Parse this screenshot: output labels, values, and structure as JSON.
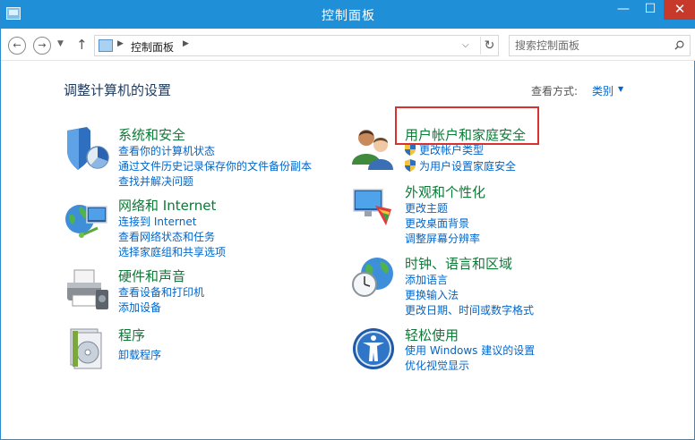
{
  "window": {
    "title": "控制面板",
    "min": "—",
    "max": "☐",
    "close": "✕"
  },
  "nav": {
    "back": "←",
    "forward": "→",
    "up": "↑",
    "breadcrumb": "控制面板",
    "search_placeholder": "搜索控制面板"
  },
  "header": {
    "title": "调整计算机的设置",
    "view_label": "查看方式:",
    "view_value": "类别"
  },
  "categories": [
    {
      "title": "系统和安全",
      "links": [
        "查看你的计算机状态",
        "通过文件历史记录保存你的文件备份副本",
        "查找并解决问题"
      ]
    },
    {
      "title": "网络和 Internet",
      "links": [
        "连接到 Internet",
        "查看网络状态和任务",
        "选择家庭组和共享选项"
      ]
    },
    {
      "title": "硬件和声音",
      "links": [
        "查看设备和打印机",
        "添加设备"
      ]
    },
    {
      "title": "程序",
      "links": [
        "卸载程序"
      ]
    },
    {
      "title": "用户帐户和家庭安全",
      "links": [
        "更改帐户类型",
        "为用户设置家庭安全"
      ]
    },
    {
      "title": "外观和个性化",
      "links": [
        "更改主题",
        "更改桌面背景",
        "调整屏幕分辨率"
      ]
    },
    {
      "title": "时钟、语言和区域",
      "links": [
        "添加语言",
        "更换输入法",
        "更改日期、时间或数字格式"
      ]
    },
    {
      "title": "轻松使用",
      "links": [
        "使用 Windows 建议的设置",
        "优化视觉显示"
      ]
    }
  ],
  "colors": {
    "accent": "#1f8fd8",
    "category_title": "#0d7a36",
    "link": "#0066cc",
    "highlight": "#d93030"
  }
}
